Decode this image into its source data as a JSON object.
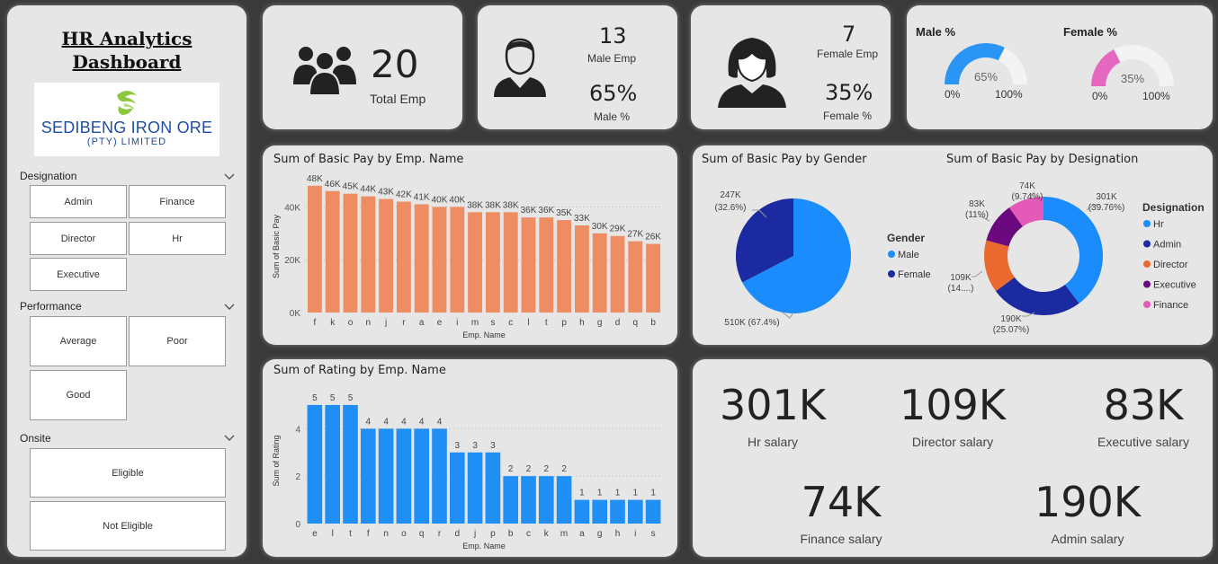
{
  "sidebar": {
    "title_line1": "HR Analytics",
    "title_line2": "Dashboard",
    "logo_line1": "SEDIBENG IRON ORE",
    "logo_line2": "(PTY) LIMITED",
    "designation_label": "Designation",
    "designation_options": [
      "Admin",
      "Finance",
      "Director",
      "Hr",
      "Executive"
    ],
    "performance_label": "Performance",
    "performance_options": [
      "Average",
      "Poor",
      "Good"
    ],
    "onsite_label": "Onsite",
    "onsite_options": [
      "Eligible",
      "Not Eligible"
    ]
  },
  "kpis": {
    "total_emp_value": "20",
    "total_emp_label": "Total Emp",
    "male_emp_value": "13",
    "male_emp_label": "Male Emp",
    "male_pct_value": "65%",
    "male_pct_label": "Male %",
    "female_emp_value": "7",
    "female_emp_label": "Female Emp",
    "female_pct_value": "35%",
    "female_pct_label": "Female %"
  },
  "gauges": {
    "male_title": "Male %",
    "male_value": 65,
    "male_value_label": "65%",
    "female_title": "Female %",
    "female_value": 35,
    "female_value_label": "35%",
    "min_label": "0%",
    "max_label": "100%",
    "male_color": "#2b95f5",
    "female_color": "#e667c0",
    "track_color": "#f3f3f3"
  },
  "icons": [
    "people-group-icon",
    "male-user-icon",
    "female-user-icon",
    "chevron-down-icon",
    "company-logo-icon"
  ],
  "salaries": [
    {
      "value": "301K",
      "label": "Hr salary"
    },
    {
      "value": "109K",
      "label": "Director salary"
    },
    {
      "value": "83K",
      "label": "Executive salary"
    },
    {
      "value": "74K",
      "label": "Finance salary"
    },
    {
      "value": "190K",
      "label": "Admin salary"
    }
  ],
  "chart_data": [
    {
      "type": "bar",
      "title": "Sum of Basic Pay by Emp. Name",
      "xlabel": "Emp. Name",
      "ylabel": "Sum of Basic Pay",
      "categories": [
        "f",
        "k",
        "o",
        "n",
        "j",
        "r",
        "a",
        "e",
        "i",
        "m",
        "s",
        "c",
        "l",
        "t",
        "p",
        "h",
        "g",
        "d",
        "q",
        "b"
      ],
      "values": [
        48000,
        46000,
        45000,
        44000,
        43000,
        42000,
        41000,
        40000,
        40000,
        38000,
        38000,
        38000,
        36000,
        36000,
        35000,
        33000,
        30000,
        29000,
        27000,
        26000
      ],
      "data_labels": [
        "48K",
        "46K",
        "45K",
        "44K",
        "43K",
        "42K",
        "41K",
        "40K",
        "40K",
        "38K",
        "38K",
        "38K",
        "36K",
        "36K",
        "35K",
        "33K",
        "30K",
        "29K",
        "27K",
        "26K"
      ],
      "yticks": [
        "0K",
        "20K",
        "40K"
      ],
      "ylim": [
        0,
        50000
      ],
      "color": "#ee8c62"
    },
    {
      "type": "bar",
      "title": "Sum of Rating by Emp. Name",
      "xlabel": "Emp. Name",
      "ylabel": "Sum of Rating",
      "categories": [
        "e",
        "l",
        "t",
        "f",
        "n",
        "o",
        "q",
        "r",
        "d",
        "j",
        "p",
        "b",
        "c",
        "k",
        "m",
        "a",
        "g",
        "h",
        "i",
        "s"
      ],
      "values": [
        5,
        5,
        5,
        4,
        4,
        4,
        4,
        4,
        3,
        3,
        3,
        2,
        2,
        2,
        2,
        1,
        1,
        1,
        1,
        1
      ],
      "yticks": [
        "0",
        "2",
        "4"
      ],
      "ylim": [
        0,
        5.3
      ],
      "color": "#1f8ff5"
    },
    {
      "type": "pie",
      "title": "Sum of Basic Pay by Gender",
      "legend_title": "Gender",
      "slices": [
        {
          "name": "Male",
          "value": 510000,
          "label": "510K (67.4%)",
          "color": "#1a8cfb"
        },
        {
          "name": "Female",
          "value": 247000,
          "label_line1": "247K",
          "label_line2": "(32.6%)",
          "color": "#1b2aa0"
        }
      ]
    },
    {
      "type": "pie",
      "title": "Sum of Basic Pay by Designation",
      "legend_title": "Designation",
      "slices": [
        {
          "name": "Hr",
          "value": 301000,
          "label_line1": "301K",
          "label_line2": "(39.76%)",
          "color": "#1a8cfb"
        },
        {
          "name": "Admin",
          "value": 190000,
          "label_line1": "190K",
          "label_line2": "(25.07%)",
          "color": "#1b2aa0"
        },
        {
          "name": "Director",
          "value": 109000,
          "label_line1": "109K",
          "label_line2": "(14....)",
          "color": "#e9692f"
        },
        {
          "name": "Executive",
          "value": 83000,
          "label_line1": "83K",
          "label_line2": "(11%)",
          "color": "#6a0a7e"
        },
        {
          "name": "Finance",
          "value": 74000,
          "label_line1": "74K",
          "label_line2": "(9.74%)",
          "color": "#e559b8"
        }
      ]
    }
  ]
}
